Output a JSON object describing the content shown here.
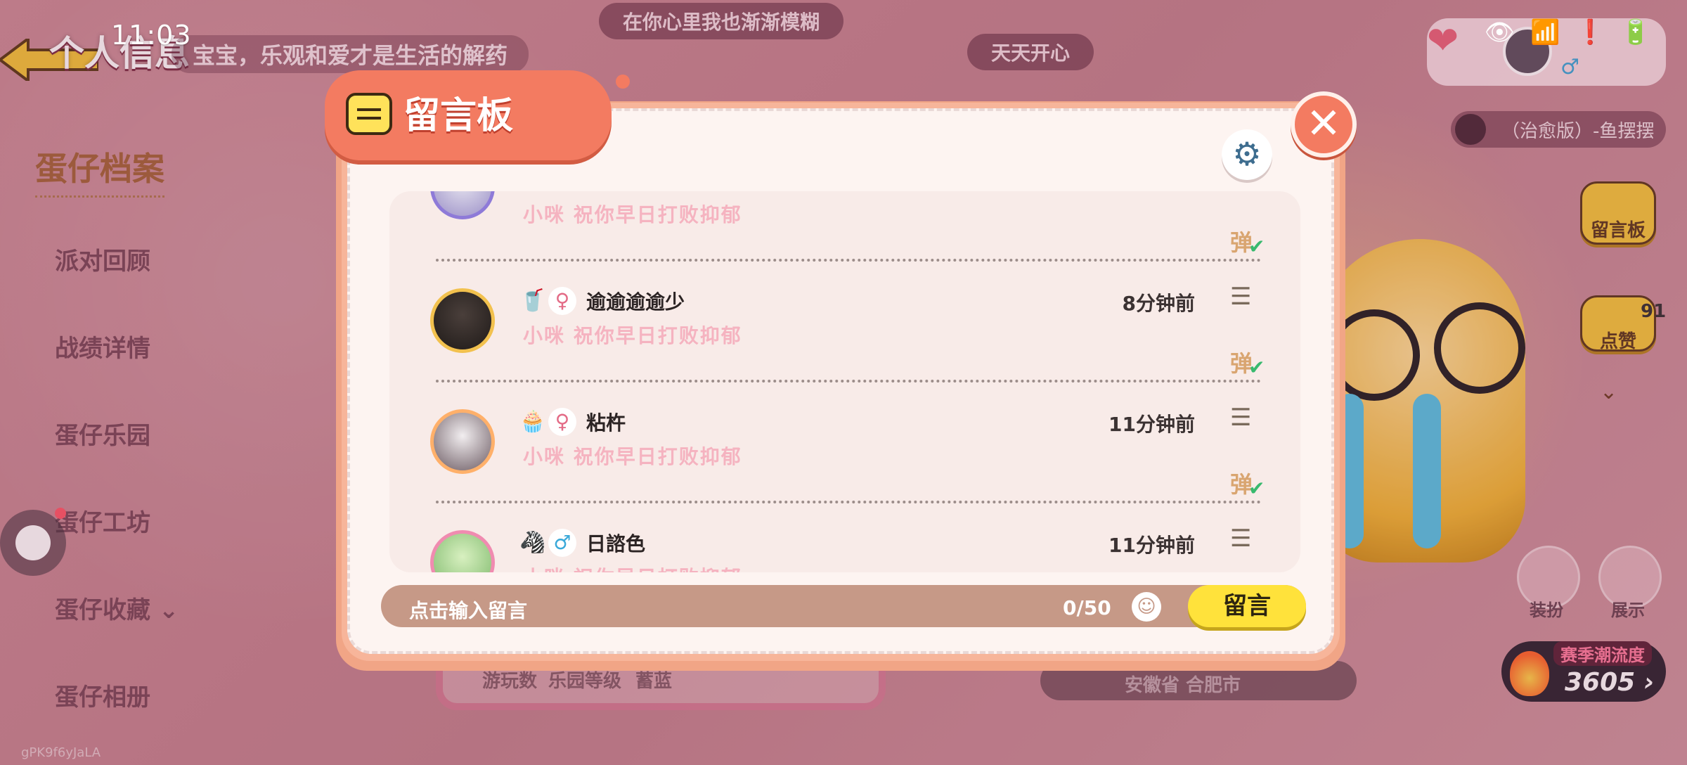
{
  "status_bar": {
    "time": "11:03"
  },
  "background": {
    "top_banner_center": "在你心里我也渐渐模糊",
    "top_banner_right": "天天开心",
    "left_panel": {
      "title": "个人信息",
      "motto": "宝宝，乐观和爱才是生活的解药",
      "section_header": "蛋仔档案",
      "items": [
        {
          "label": "派对回顾"
        },
        {
          "label": "战绩详情"
        },
        {
          "label": "蛋仔乐园"
        },
        {
          "label": "蛋仔工坊"
        },
        {
          "label": "蛋仔收藏"
        },
        {
          "label": "蛋仔相册"
        }
      ],
      "footer_id": "gPK9f6yJaLA"
    },
    "right_panel": {
      "song": "（治愈版）-鱼摆摆",
      "message_board_btn": "留言板",
      "like_btn": "点赞",
      "like_count": "91",
      "outfit_btn": "装扮",
      "show_btn": "展示",
      "heat_title": "赛季潮流度",
      "heat_value": "3605",
      "chevron_down": "⌄"
    },
    "bottom_stats": [
      "游玩数",
      "乐园等级",
      "蓄蓝",
      "安徽省 合肥市"
    ]
  },
  "modal": {
    "title": "留言板",
    "messages": [
      {
        "name": "",
        "gender": "",
        "text": "小咪 祝你早日打败抑郁",
        "time": "",
        "danmu": "弹"
      },
      {
        "name": "逾逾逾逾少",
        "gender": "♀",
        "text": "小咪 祝你早日打败抑郁",
        "time": "8分钟前",
        "danmu": "弹"
      },
      {
        "name": "粘杵",
        "gender": "♀",
        "text": "小咪 祝你早日打败抑郁",
        "time": "11分钟前",
        "danmu": "弹"
      },
      {
        "name": "日諮色",
        "gender": "♂",
        "text": "小咪 祝你早日打败抑郁",
        "time": "11分钟前",
        "danmu": ""
      }
    ],
    "input": {
      "placeholder": "点击输入留言",
      "counter": "0/50"
    },
    "send_label": "留言"
  },
  "colors": {
    "modal_accent": "#f37b61",
    "send_button": "#ffe23b",
    "message_text": "#f5b3c0",
    "female_icon": "#e36b86",
    "male_icon": "#3aa9d9"
  }
}
